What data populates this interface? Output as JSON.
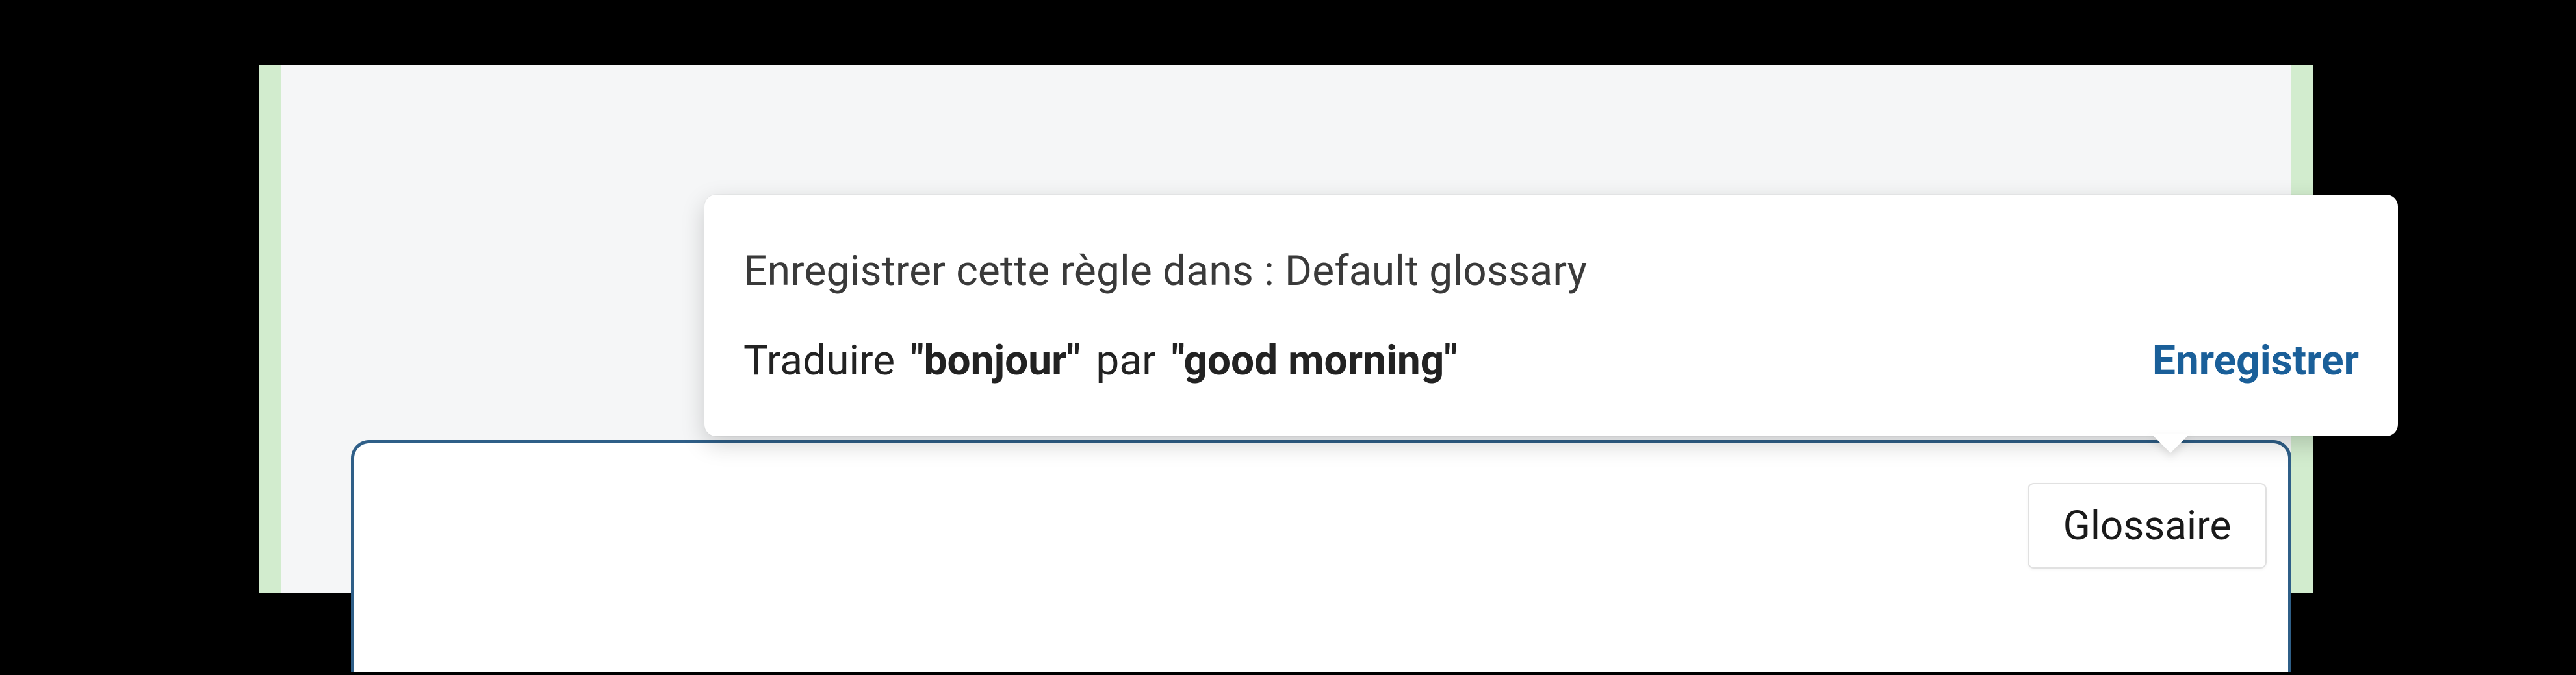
{
  "popup": {
    "save_rule_prefix": "Enregistrer cette règle dans :",
    "glossary_name": "Default glossary",
    "translate_label": "Traduire",
    "source_term": "\"bonjour\"",
    "by_label": "par",
    "target_term": "\"good morning\"",
    "save_action": "Enregistrer"
  },
  "glossary_tab": {
    "label": "Glossaire"
  }
}
